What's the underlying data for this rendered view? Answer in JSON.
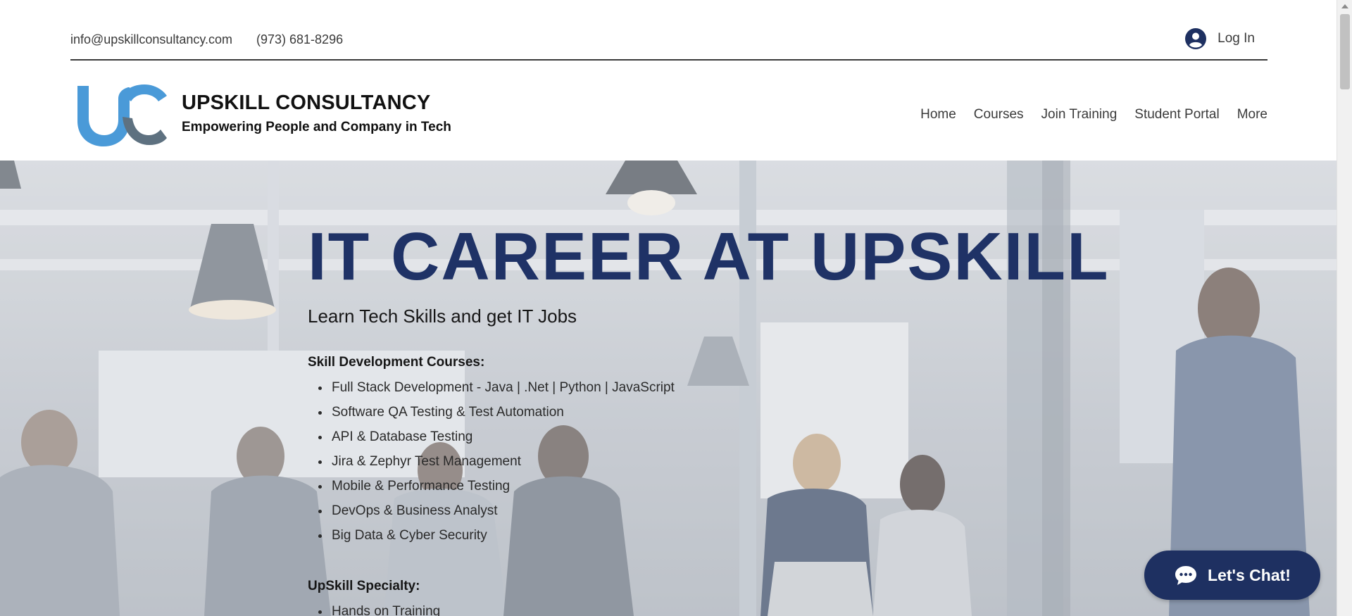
{
  "topbar": {
    "email": "info@upskillconsultancy.com",
    "phone": "(973) 681-8296",
    "login_label": "Log In",
    "login_icon": "user-avatar-icon"
  },
  "header": {
    "logo_icon": "uc-logo",
    "brand_title": "UPSKILL CONSULTANCY",
    "tagline": "Empowering People and Company in Tech",
    "nav": [
      {
        "label": "Home"
      },
      {
        "label": "Courses"
      },
      {
        "label": "Join Training"
      },
      {
        "label": "Student Portal"
      },
      {
        "label": "More"
      }
    ]
  },
  "hero": {
    "title": "IT CAREER AT UPSKILL",
    "subtitle": "Learn Tech Skills and get IT Jobs",
    "courses_heading": "Skill Development Courses:",
    "courses": [
      "Full Stack Development - Java | .Net | Python | JavaScript",
      "Software QA Testing & Test Automation",
      "API & Database Testing",
      "Jira & Zephyr Test Management",
      "Mobile & Performance Testing",
      "DevOps & Business Analyst",
      "Big Data & Cyber Security"
    ],
    "specialty_heading": "UpSkill Specialty:",
    "specialty": [
      "Hands on Training"
    ]
  },
  "chat": {
    "label": "Let's Chat!",
    "icon": "chat-bubble-icon"
  },
  "colors": {
    "brand_navy": "#1f3266",
    "logo_blue": "#4a9ad8",
    "logo_gray": "#5e7180",
    "chat_bg": "#1e3061"
  }
}
